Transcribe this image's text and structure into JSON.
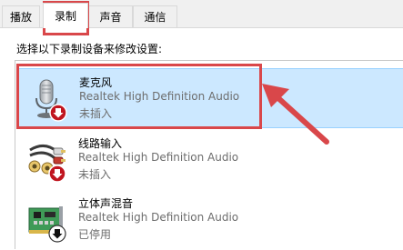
{
  "tabs": [
    {
      "label": "播放",
      "selected": false
    },
    {
      "label": "录制",
      "selected": true
    },
    {
      "label": "声音",
      "selected": false
    },
    {
      "label": "通信",
      "selected": false
    }
  ],
  "instruction": "选择以下录制设备来修改设置:",
  "devices": [
    {
      "name": "麦克风",
      "driver": "Realtek High Definition Audio",
      "status": "未插入",
      "icon": "microphone-icon",
      "badge": "red-down-arrow-badge",
      "selected": true
    },
    {
      "name": "线路输入",
      "driver": "Realtek High Definition Audio",
      "status": "未插入",
      "icon": "line-in-cable-icon",
      "badge": "red-down-arrow-badge",
      "selected": false
    },
    {
      "name": "立体声混音",
      "driver": "Realtek High Definition Audio",
      "status": "已停用",
      "icon": "sound-card-icon",
      "badge": "black-down-arrow-badge",
      "selected": false
    }
  ],
  "colors": {
    "selection_bg": "#cce8ff",
    "selection_border": "#99d1ff",
    "annotation_red": "#d9474a",
    "badge_red": "#c0151f"
  }
}
